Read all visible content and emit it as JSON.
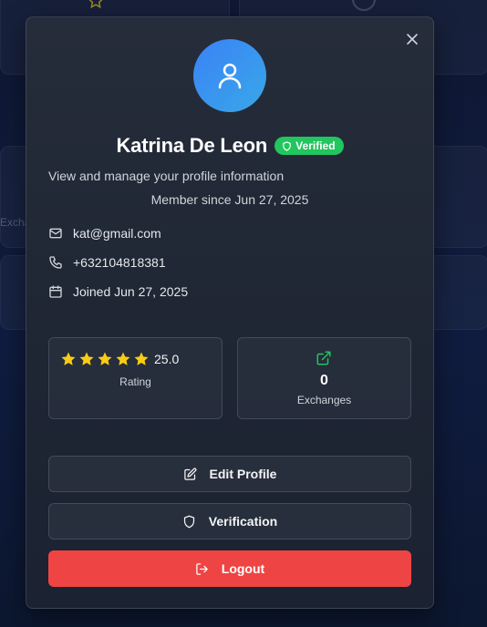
{
  "background": {
    "partial_text": "Exchai"
  },
  "profile": {
    "name": "Katrina De Leon",
    "verified_badge": "Verified",
    "subtitle": "View and manage your profile information",
    "member_since": "Member since Jun 27, 2025",
    "email": "kat@gmail.com",
    "phone": "+632104818381",
    "joined": "Joined Jun 27, 2025"
  },
  "stats": {
    "rating": {
      "stars": 5,
      "value": "25.0",
      "label": "Rating"
    },
    "exchanges": {
      "value": "0",
      "label": "Exchanges"
    }
  },
  "actions": {
    "edit_profile": "Edit Profile",
    "verification": "Verification",
    "logout": "Logout"
  },
  "colors": {
    "verified": "#22c55e",
    "logout": "#ef4444",
    "star": "#facc15",
    "exchange_icon": "#22c55e",
    "avatar": "#3b82f6"
  },
  "icons": [
    "close-icon",
    "user-icon",
    "shield-icon",
    "mail-icon",
    "phone-icon",
    "calendar-icon",
    "star-icon",
    "external-link-icon",
    "edit-icon",
    "logout-icon"
  ]
}
